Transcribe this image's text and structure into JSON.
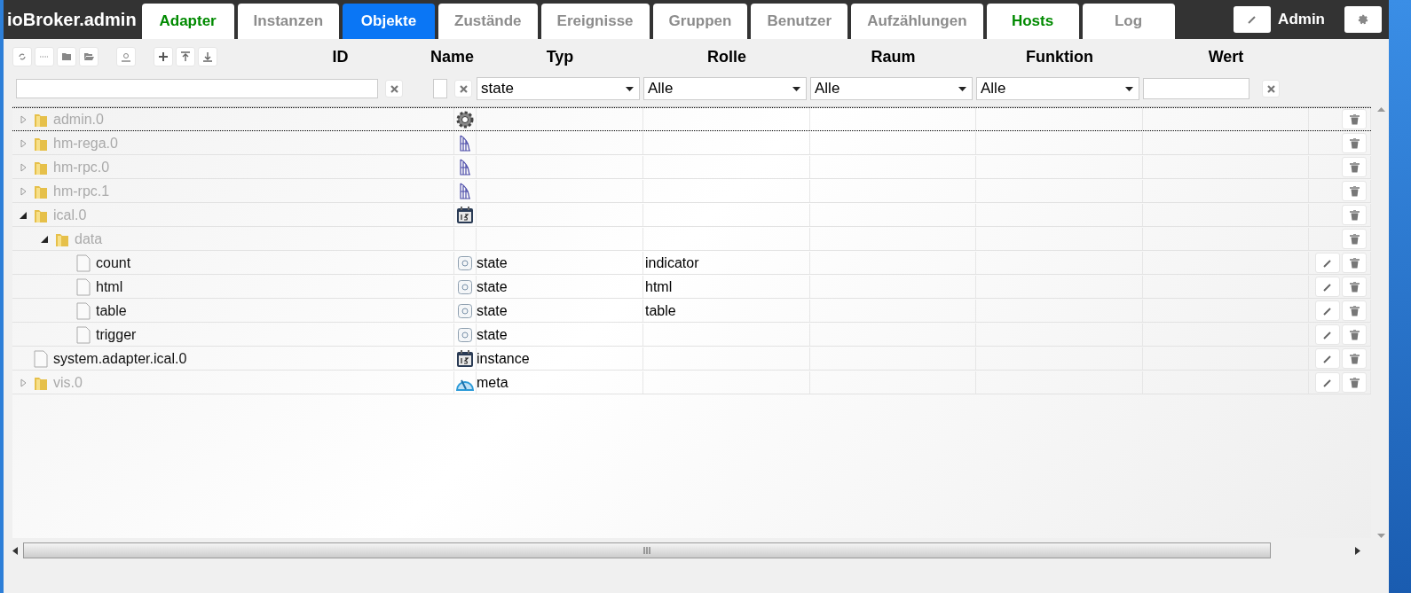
{
  "app_title": "ioBroker.admin",
  "tabs": [
    {
      "label": "Adapter",
      "selected": false,
      "color": "#008a00"
    },
    {
      "label": "Instanzen",
      "selected": false,
      "color": "#8c8c8c"
    },
    {
      "label": "Objekte",
      "selected": true
    },
    {
      "label": "Zustände",
      "selected": false,
      "color": "#8c8c8c"
    },
    {
      "label": "Ereignisse",
      "selected": false,
      "color": "#8c8c8c"
    },
    {
      "label": "Gruppen",
      "selected": false,
      "color": "#8c8c8c"
    },
    {
      "label": "Benutzer",
      "selected": false,
      "color": "#8c8c8c"
    },
    {
      "label": "Aufzählungen",
      "selected": false,
      "color": "#8c8c8c"
    },
    {
      "label": "Hosts",
      "selected": false,
      "color": "#008a00"
    },
    {
      "label": "Log",
      "selected": false,
      "color": "#8c8c8c"
    }
  ],
  "user": "Admin",
  "columns": [
    "ID",
    "Name",
    "Typ",
    "Rolle",
    "Raum",
    "Funktion",
    "Wert"
  ],
  "filters": {
    "type": "state",
    "role": "Alle",
    "room": "Alle",
    "function": "Alle"
  },
  "tree": [
    {
      "id": "admin.0",
      "kind": "folder",
      "expanded": false,
      "selected": true,
      "editable": false
    },
    {
      "id": "hm-rega.0",
      "kind": "folder",
      "expanded": false,
      "selected": false,
      "editable": false
    },
    {
      "id": "hm-rpc.0",
      "kind": "folder",
      "expanded": false,
      "selected": false,
      "editable": false
    },
    {
      "id": "hm-rpc.1",
      "kind": "folder",
      "expanded": false,
      "selected": false,
      "editable": false
    },
    {
      "id": "ical.0",
      "kind": "folder",
      "expanded": true,
      "selected": false,
      "editable": false,
      "children": [
        {
          "id": "data",
          "kind": "folder",
          "expanded": true,
          "selected": false,
          "editable": false,
          "children": [
            {
              "id": "count",
              "kind": "file",
              "type": "state",
              "role": "indicator",
              "selected": false,
              "editable": true
            },
            {
              "id": "html",
              "kind": "file",
              "type": "state",
              "role": "html",
              "selected": false,
              "editable": true
            },
            {
              "id": "table",
              "kind": "file",
              "type": "state",
              "role": "table",
              "selected": false,
              "editable": true
            },
            {
              "id": "trigger",
              "kind": "file",
              "type": "state",
              "selected": false,
              "editable": true
            }
          ]
        }
      ]
    },
    {
      "id": "system.adapter.ical.0",
      "kind": "file",
      "type": "instance",
      "selected": false,
      "editable": true
    },
    {
      "id": "vis.0",
      "kind": "folder",
      "type": "meta",
      "expanded": false,
      "selected": false,
      "editable": true
    }
  ]
}
